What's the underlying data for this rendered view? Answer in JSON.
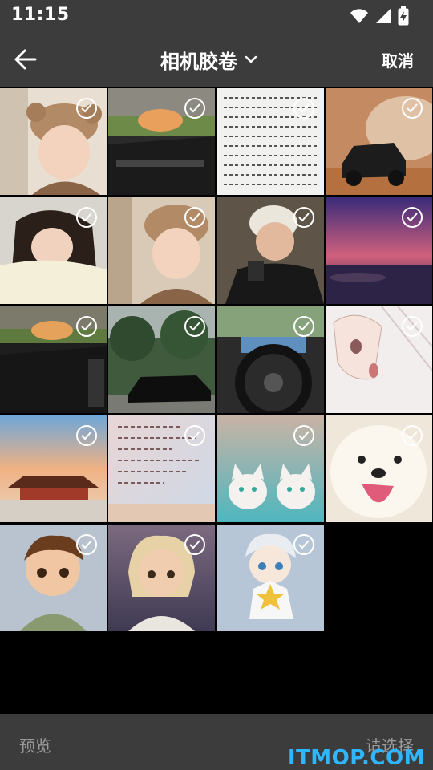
{
  "status_bar": {
    "time": "11:15",
    "icons": [
      "wifi-icon",
      "signal-icon",
      "battery-charging-icon"
    ]
  },
  "app_bar": {
    "back_icon": "arrow-left-icon",
    "title": "相机胶卷",
    "title_dropdown_icon": "chevron-down-icon",
    "cancel_label": "取消"
  },
  "photos": [
    {
      "subject": "girl in bear hat",
      "selected": true
    },
    {
      "subject": "car interior at sunset",
      "selected": true
    },
    {
      "subject": "handwritten notes",
      "selected": true
    },
    {
      "subject": "off-road SUV in desert",
      "selected": true
    },
    {
      "subject": "girl lying on pillow",
      "selected": true
    },
    {
      "subject": "girl in bear hat",
      "selected": true
    },
    {
      "subject": "young man with camera",
      "selected": true
    },
    {
      "subject": "purple sunset over sea",
      "selected": true
    },
    {
      "subject": "car door interior",
      "selected": true
    },
    {
      "subject": "black sedan under trees",
      "selected": true
    },
    {
      "subject": "steering wheel",
      "selected": true
    },
    {
      "subject": "anime sketch",
      "selected": true
    },
    {
      "subject": "Forbidden City at sunset",
      "selected": true
    },
    {
      "subject": "handwritten letter",
      "selected": true
    },
    {
      "subject": "two white kittens",
      "selected": true
    },
    {
      "subject": "smiling white puppy",
      "selected": true
    },
    {
      "subject": "cartoon boy",
      "selected": true
    },
    {
      "subject": "cartoon girl",
      "selected": true
    },
    {
      "subject": "chibi boy with star",
      "selected": true
    }
  ],
  "check_icon": "check-circle-icon",
  "bottom_bar": {
    "preview_label": "预览",
    "confirm_label": "请选择"
  },
  "watermark": "ITMOP.COM",
  "colors": {
    "bar_bg": "#3c3c3c",
    "page_bg": "#000000",
    "disabled_text": "#9a9a9a",
    "watermark": "#2fb6ff"
  }
}
